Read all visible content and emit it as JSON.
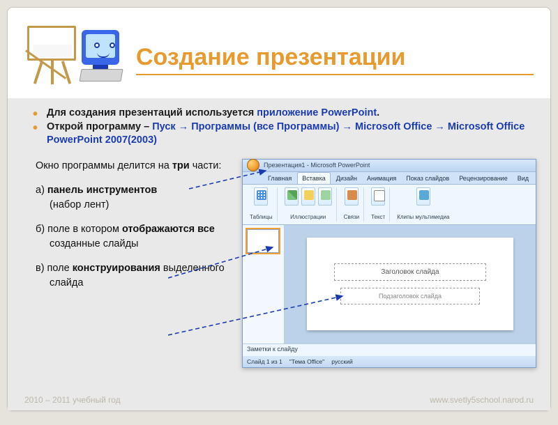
{
  "title": "Создание презентации",
  "intro": {
    "line1_a": "Для создания презентаций используется ",
    "line1_b": "приложение PowerPoint",
    "line1_c": ".",
    "line2_a": "Открой программу – ",
    "line2_b": "Пуск → Программы  (все Программы) → Microsoft Office → Microsoft Office PowerPoint 2007(2003)"
  },
  "body": {
    "lead_a": "Окно программы делится на ",
    "lead_b": "три",
    "lead_c": " части:",
    "a_pref": "а) ",
    "a_bold": "панель инструментов",
    "a_rest": "(набор лент)",
    "b_pref": "б) поле в котором ",
    "b_bold": "отображаются все",
    "b_rest": " созданные слайды",
    "c_pref": "в) поле ",
    "c_bold": "конструирования",
    "c_rest": " выделенного слайда"
  },
  "ppt": {
    "window_title": "Презентация1 - Microsoft PowerPoint",
    "tabs": {
      "home": "Главная",
      "insert": "Вставка",
      "design": "Дизайн",
      "anim": "Анимация",
      "show": "Показ слайдов",
      "review": "Рецензирование",
      "view": "Вид"
    },
    "groups": {
      "tables": "Таблицы",
      "illus": "Иллюстрации",
      "links": "Связи",
      "text": "Текст",
      "media": "Клипы мультимедиа"
    },
    "placeholders": {
      "title": "Заголовок слайда",
      "subtitle": "Подзаголовок слайда"
    },
    "notes": "Заметки к слайду",
    "status": {
      "slide": "Слайд 1 из 1",
      "theme": "\"Тема Office\"",
      "lang": "русский"
    }
  },
  "footer": {
    "left": "2010 – 2011 учебный год",
    "right": "www.svetly5school.narod.ru"
  }
}
